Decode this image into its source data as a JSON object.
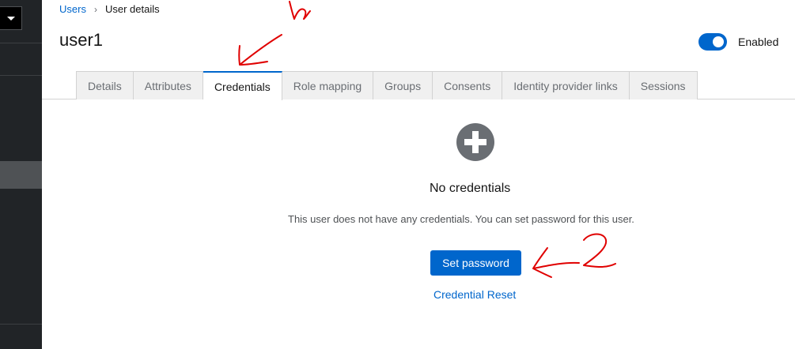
{
  "breadcrumb": {
    "parent": "Users",
    "separator": "›",
    "current": "User details"
  },
  "page": {
    "title": "user1",
    "enabled_label": "Enabled",
    "enabled": true
  },
  "tabs": [
    {
      "label": "Details",
      "active": false
    },
    {
      "label": "Attributes",
      "active": false
    },
    {
      "label": "Credentials",
      "active": true
    },
    {
      "label": "Role mapping",
      "active": false
    },
    {
      "label": "Groups",
      "active": false
    },
    {
      "label": "Consents",
      "active": false
    },
    {
      "label": "Identity provider links",
      "active": false
    },
    {
      "label": "Sessions",
      "active": false
    }
  ],
  "empty_state": {
    "icon": "plus-circle-icon",
    "title": "No credentials",
    "body": "This user does not have any credentials. You can set password for this user.",
    "primary_action": "Set password",
    "secondary_action": "Credential Reset"
  },
  "colors": {
    "accent": "#0066cc",
    "sidebar": "#212427",
    "annotation": "#e00000"
  }
}
